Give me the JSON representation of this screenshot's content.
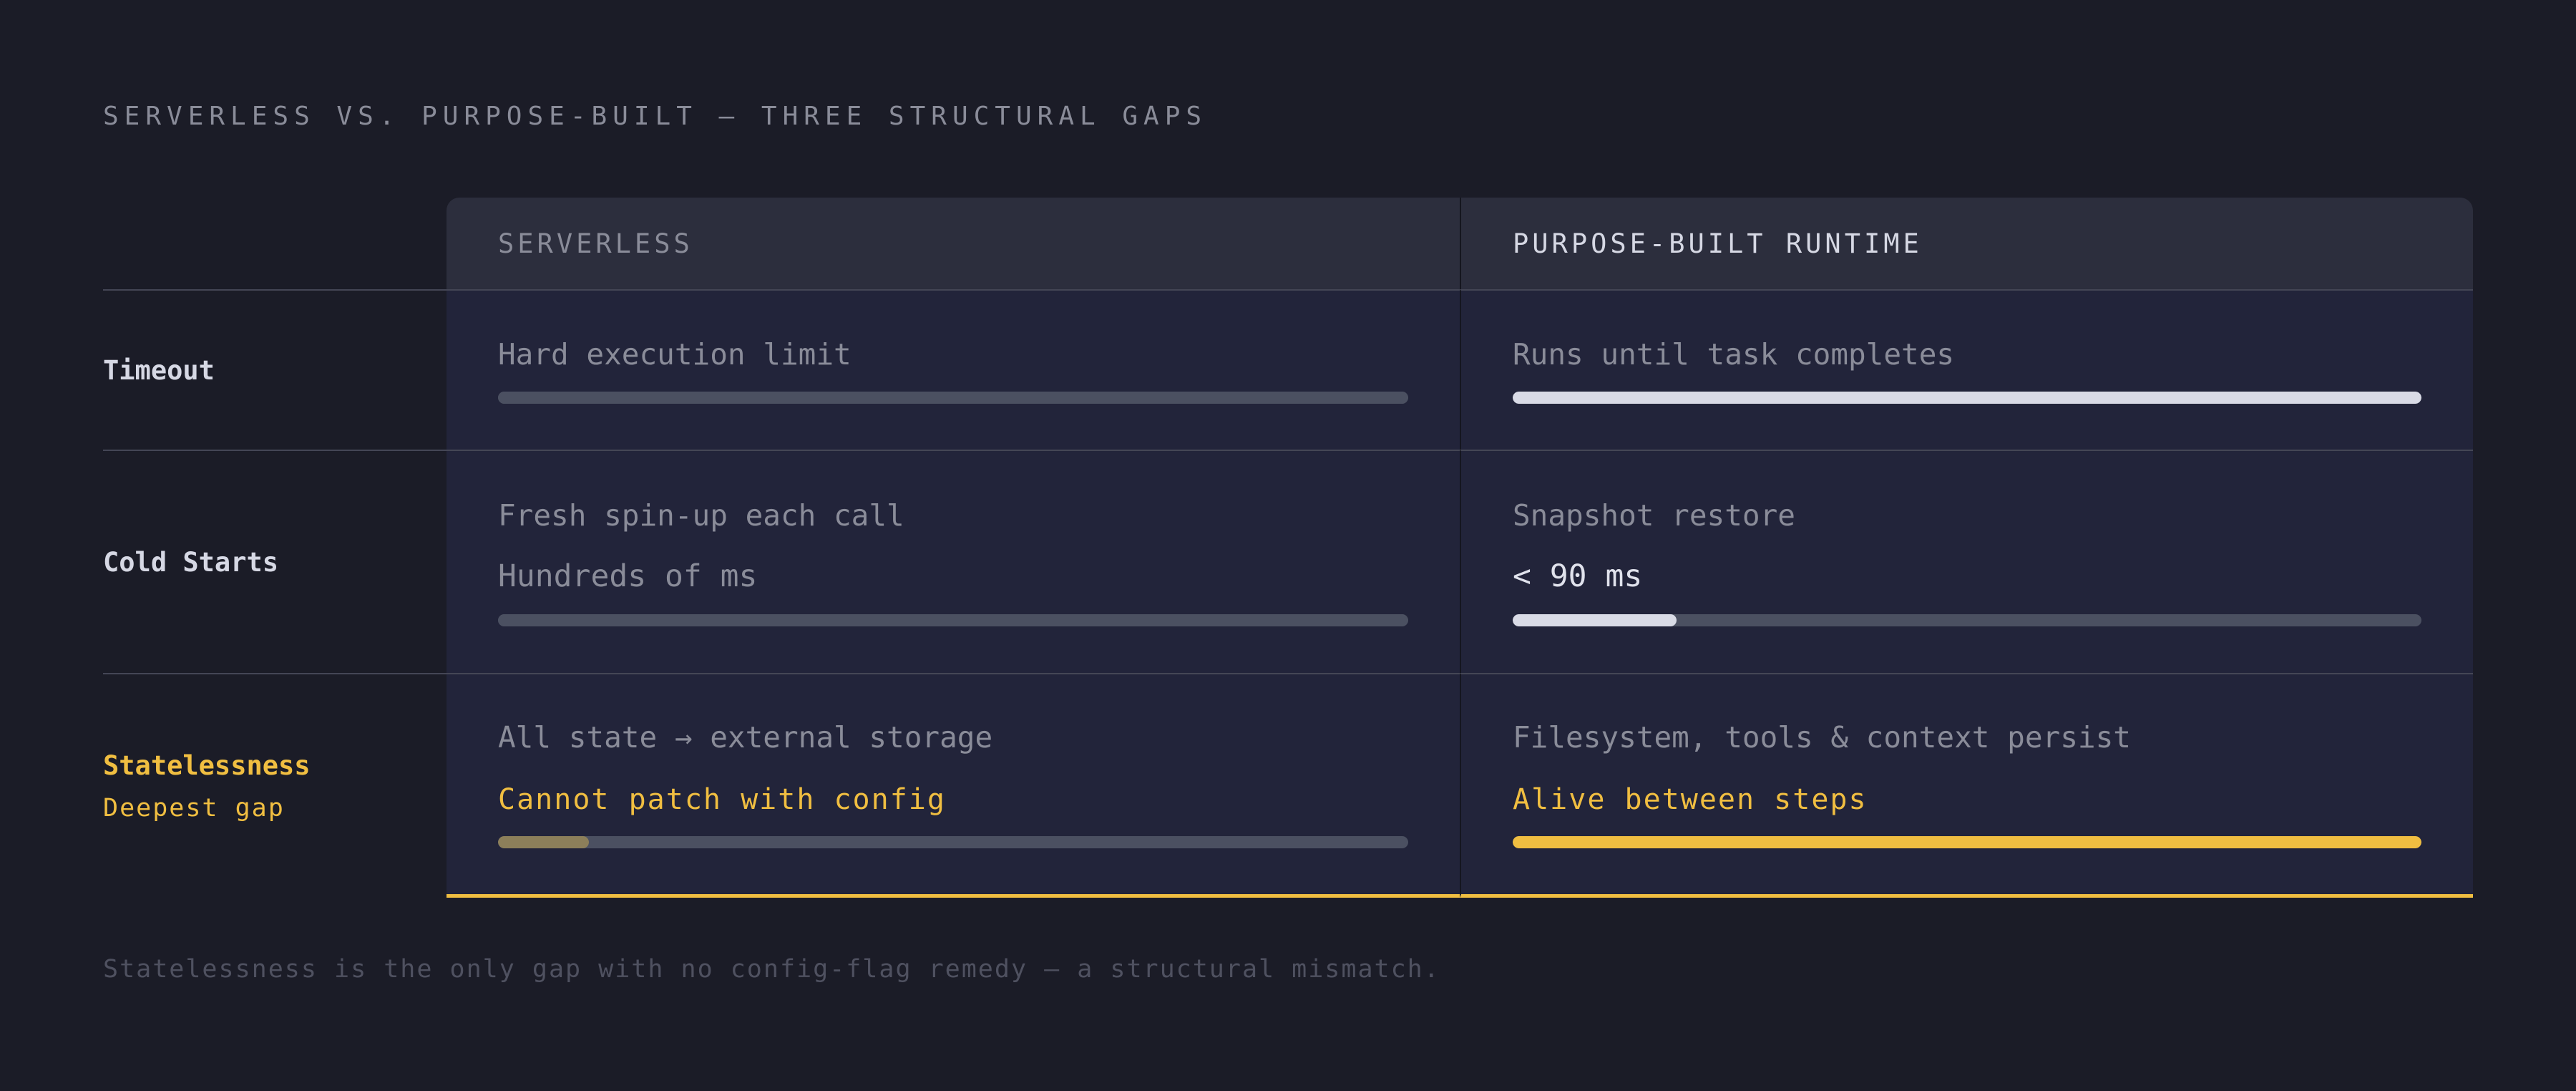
{
  "title": "SERVERLESS VS. PURPOSE-BUILT — THREE STRUCTURAL GAPS",
  "columns": {
    "left": "SERVERLESS",
    "right": "PURPOSE-BUILT RUNTIME"
  },
  "rows": [
    {
      "label": "Timeout",
      "sublabel": "",
      "left": {
        "line1": "Hard execution limit",
        "line2": "",
        "level": 1.0
      },
      "right": {
        "line1": "Runs until task completes",
        "line2": "",
        "level": 1.0
      }
    },
    {
      "label": "Cold Starts",
      "sublabel": "",
      "left": {
        "line1": "Fresh spin-up each call",
        "line2": "Hundreds of ms",
        "level": 1.0
      },
      "right": {
        "line1": "Snapshot restore",
        "line2": "< 90 ms",
        "level": 0.18
      }
    },
    {
      "label": "Statelessness",
      "sublabel": "Deepest gap",
      "left": {
        "line1": "All state → external storage",
        "line2": "Cannot patch with config",
        "level": 0.1
      },
      "right": {
        "line1": "Filesystem, tools & context persist",
        "line2": "Alive between steps",
        "level": 1.0
      }
    }
  ],
  "colors": {
    "background": "#1b1c27",
    "accent": "#f0be41",
    "bar_track": "#4b5061",
    "bar_bright": "#d9dbe6",
    "bar_muted_accent": "#8c7f5a"
  },
  "footnote": "Statelessness is the only gap with no config-flag remedy — a structural mismatch."
}
